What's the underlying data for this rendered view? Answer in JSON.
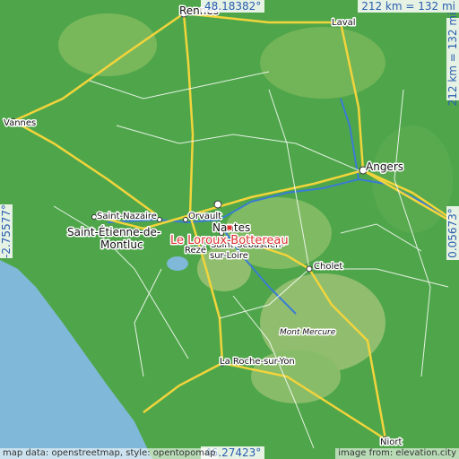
{
  "coords": {
    "top": "48.18382°",
    "bottom": "46.27423°",
    "left": "-2.75577°",
    "right": "0.05673°"
  },
  "scale": {
    "horizontal": "212 km = 132 mi",
    "vertical": "212 km = 132 mi"
  },
  "credits": {
    "left": "map data: openstreetmap, style: opentopomap",
    "right": "image from: elevation.city"
  },
  "highlight": {
    "name": "Le Loroux-Bottereau",
    "color": "#e03030"
  },
  "places": {
    "rennes": "Rennes",
    "laval": "Laval",
    "vannes": "Vannes",
    "angers": "Angers",
    "cholet": "Cholet",
    "saint_nazaire": "Saint-Nazaire",
    "orvault": "Orvault",
    "nantes": "Nantes",
    "saint_etienne_1": "Saint-Étienne-de-",
    "saint_etienne_2": "Montluc",
    "reze": "Rezé",
    "saint_sebastien_1": "Saint-Sébastien-",
    "saint_sebastien_2": "sur-Loire",
    "mont_mercure": "Mont Mercure",
    "la_roche": "La Roche-sur-Yon",
    "niort": "Niort"
  },
  "colors": {
    "sea": "#7fb8d8",
    "land": "#4fa64a",
    "highland": "#c8d28c",
    "roads_major": "#f2d43c",
    "roads_minor": "#ffffff",
    "rivers": "#3a7bd5",
    "coord_text": "#2a5db0"
  }
}
